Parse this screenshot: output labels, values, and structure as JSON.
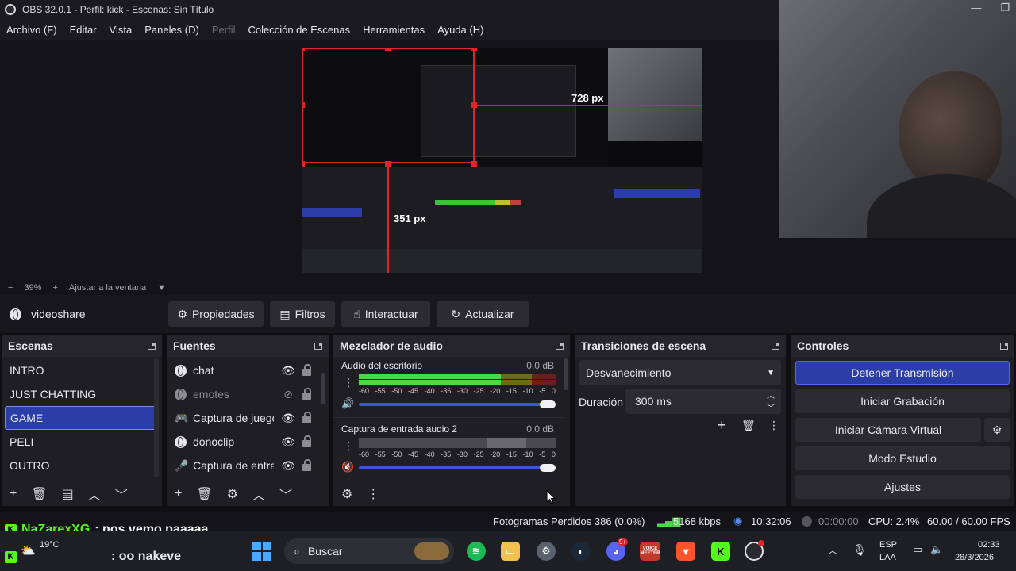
{
  "window": {
    "title": "OBS 32.0.1 - Perfil: kick - Escenas: Sin Título",
    "minimize": "—",
    "restore": "❐"
  },
  "menu": [
    "Archivo (F)",
    "Editar",
    "Vista",
    "Paneles (D)",
    "Perfil",
    "Colección de Escenas",
    "Herramientas",
    "Ayuda (H)"
  ],
  "menu_disabled_index": 4,
  "preview": {
    "measure_label_1": "728 px",
    "measure_label_2": "351 px",
    "zoom": "39%",
    "fit_label": "Ajustar a la ventana"
  },
  "source_toolbar": {
    "source_name": "videoshare",
    "properties": "Propiedades",
    "filters": "Filtros",
    "interact": "Interactuar",
    "refresh": "Actualizar"
  },
  "scenes": {
    "title": "Escenas",
    "items": [
      "INTRO",
      "JUST CHATTING",
      "GAME",
      "PELI",
      "OUTRO"
    ],
    "selected": "GAME"
  },
  "sources": {
    "title": "Fuentes",
    "items": [
      {
        "name": "chat",
        "icon": "globe-icon",
        "visible": true
      },
      {
        "name": "emotes",
        "icon": "globe-icon",
        "visible": false
      },
      {
        "name": "Captura de juego",
        "icon": "gamepad-icon",
        "visible": true
      },
      {
        "name": "donoclip",
        "icon": "globe-icon",
        "visible": true
      },
      {
        "name": "Captura de entrada",
        "icon": "microphone-icon",
        "visible": true
      }
    ]
  },
  "mixer": {
    "title": "Mezclador de audio",
    "channels": [
      {
        "name": "Audio del escritorio",
        "db": "0.0 dB",
        "level": 0.72
      },
      {
        "name": "Captura de entrada audio 2",
        "db": "0.0 dB",
        "level": 0.0,
        "muted": true
      }
    ],
    "ticks": [
      "-60",
      "-55",
      "-50",
      "-45",
      "-40",
      "-35",
      "-30",
      "-25",
      "-20",
      "-15",
      "-10",
      "-5",
      "0"
    ]
  },
  "transitions": {
    "title": "Transiciones de escena",
    "selected": "Desvanecimiento",
    "duration_label": "Duración",
    "duration_value": "300 ms"
  },
  "controls": {
    "title": "Controles",
    "stop_stream": "Detener Transmisión",
    "start_recording": "Iniciar Grabación",
    "start_virtual_cam": "Iniciar Cámara Virtual",
    "studio_mode": "Modo Estudio",
    "settings": "Ajustes"
  },
  "status": {
    "dropped_frames": "Fotogramas Perdidos 386 (0.0%)",
    "bitrate": "5168 kbps",
    "stream_time": "10:32:06",
    "rec_time": "00:00:00",
    "cpu": "CPU: 2.4%",
    "fps": "60.00 / 60.00 FPS"
  },
  "chat_overlay": {
    "line1_user": "NaZarexXG",
    "line1_msg": ": nos vemo paaaaa",
    "line2_msg": ": oo nakeve"
  },
  "taskbar": {
    "weather_temp": "19°C",
    "search": "Buscar",
    "lang": "ESP",
    "lang2": "LAA",
    "time": "02:33",
    "date": "28/3/2026",
    "discord_badge": "9+",
    "voicemeeter_label": "VOICE\nMEETER"
  },
  "colors": {
    "accent": "#2b3ea8",
    "kick_green": "#53fc18",
    "selection_red": "#e0242b"
  }
}
